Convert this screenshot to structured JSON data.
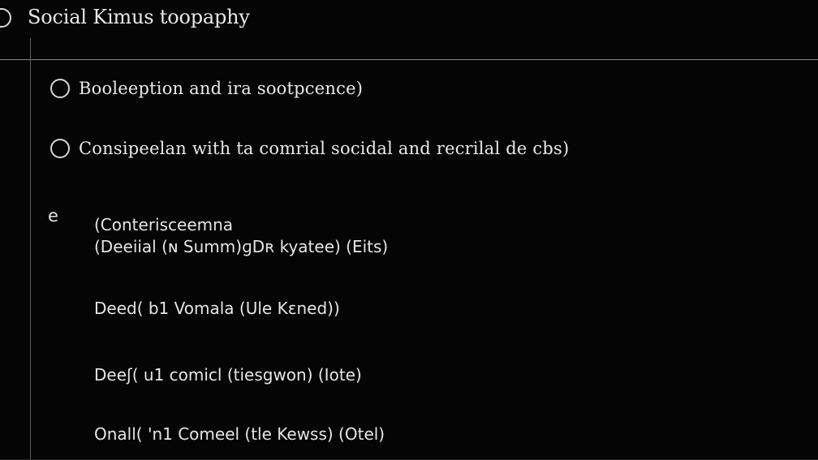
{
  "header": {
    "title": "Social Kimus toopaphy"
  },
  "options": [
    {
      "label": "Booleeption and ira sootpcence)"
    },
    {
      "label": "Consipeelan with ta comrial socidal and recrilal de cbs)"
    }
  ],
  "section": {
    "marker": "e",
    "lines": [
      "(Conterisceemna",
      "(Deeiial (ɴ Summ)ɡDʀ kyatee) (Eits)"
    ]
  },
  "rows": [
    "Deed( b1 Vomala (Ule Kɛned))",
    "Deeʃ( u1 comicl (tiesgwon) (Iote)",
    "Onall( 'n1 Comeel (tle Kewss) (Otel)"
  ]
}
